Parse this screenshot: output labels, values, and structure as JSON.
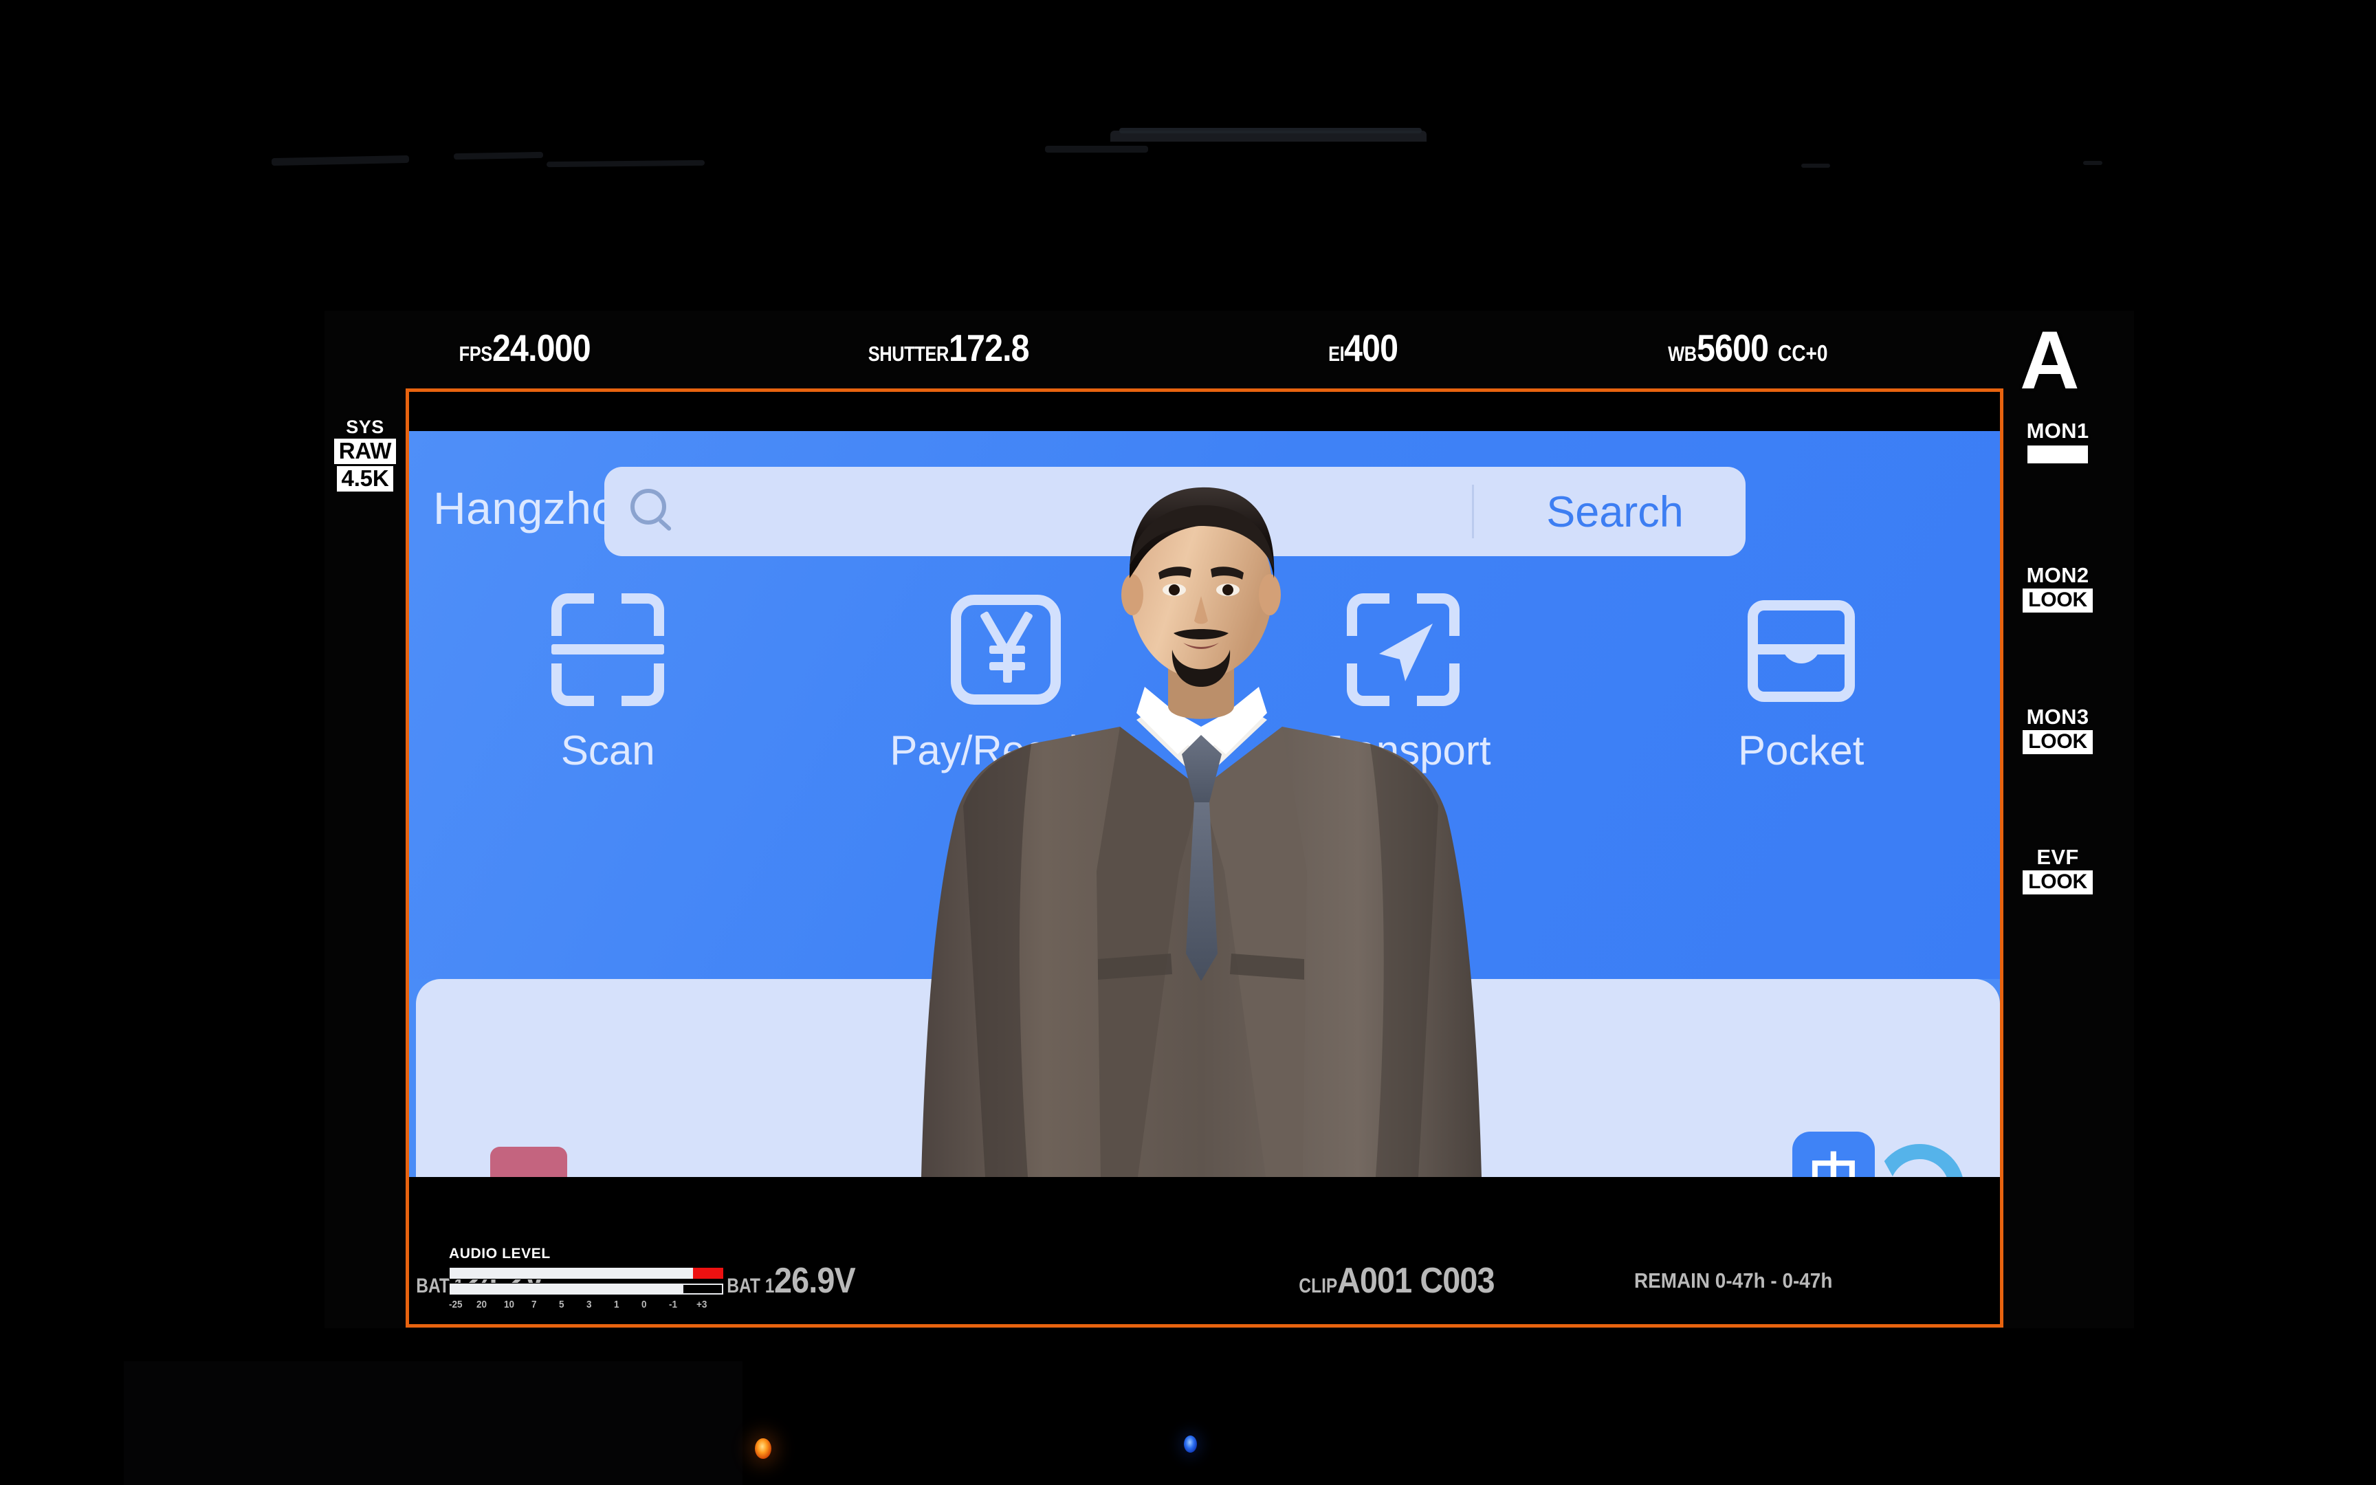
{
  "viewfinder": {
    "top_status": [
      {
        "label": "FPS",
        "value": "24.000",
        "suffix": ""
      },
      {
        "label": "SHUTTER",
        "value": "172.8",
        "suffix": ""
      },
      {
        "label": "EI",
        "value": "400",
        "suffix": ""
      },
      {
        "label": "WB",
        "value": "5600",
        "suffix": "CC+0"
      }
    ],
    "left_rail": {
      "sys_label": "SYS",
      "codec": "RAW",
      "resolution": "4.5K"
    },
    "right_rail": {
      "brand_logo": "A",
      "outputs": [
        {
          "name": "MON1",
          "mode": "",
          "bar": true
        },
        {
          "name": "MON2",
          "mode": "LOOK",
          "bar": false
        },
        {
          "name": "MON3",
          "mode": "LOOK",
          "bar": false
        },
        {
          "name": "EVF",
          "mode": "LOOK",
          "bar": false
        }
      ]
    },
    "bottom_status": {
      "battery_1_label": "BAT 1",
      "battery_1_value": "24.2V",
      "battery_2_label": "BAT 1",
      "battery_2_value": "26.9V",
      "clip_label": "CLIP",
      "clip_value": "A001 C003",
      "remain_text": "REMAIN 0-47h - 0-47h"
    },
    "audio": {
      "title": "AUDIO LEVEL",
      "ch1_level_pct": 89,
      "ch1_peak_pct": 11,
      "ch2_level_pct": 85,
      "ch2_empty_pct": 15,
      "scale": [
        "-25",
        "20",
        "10",
        "7",
        "5",
        "3",
        "1",
        "0",
        "-1",
        "+3"
      ]
    },
    "frame_color": "#e8630f"
  },
  "app": {
    "city": "Hangzhou",
    "chevron_icon": "chevron-down-icon",
    "search": {
      "placeholder": "",
      "value": "",
      "icon": "search-icon",
      "button_label": "Search"
    },
    "quick_actions": [
      {
        "label": "Scan",
        "icon": "scan-icon"
      },
      {
        "label": "Pay/Receive",
        "icon": "pay-receive-icon"
      },
      {
        "label": "Transport",
        "icon": "transport-icon"
      },
      {
        "label": "Pocket",
        "icon": "pocket-icon"
      }
    ],
    "card_tiles": [
      {
        "icon": "pink-tile-icon",
        "color": "#c4647f",
        "glyph": ""
      },
      {
        "icon": "teal-tile-icon",
        "color": "#49a8d8",
        "glyph": ""
      },
      {
        "icon": "blue-tile-icon",
        "color": "#3b7df5",
        "glyph": ""
      },
      {
        "icon": "translate-tile-icon",
        "color": "#3f83f6",
        "glyph": "中"
      }
    ],
    "accent_color": "#3d7ef2",
    "header_color": "#4a8cf7"
  },
  "indicators": [
    {
      "name": "amber-led",
      "color": "#ff9b1e"
    },
    {
      "name": "blue-led",
      "color": "#2a6ef0"
    }
  ]
}
